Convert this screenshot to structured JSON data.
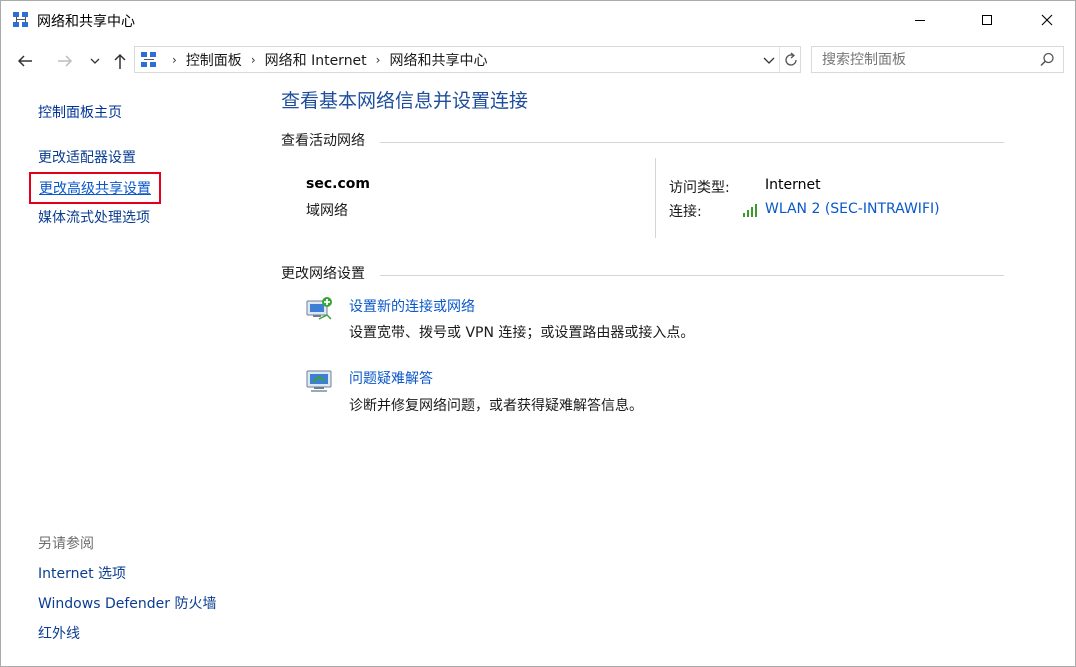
{
  "window": {
    "title": "网络和共享中心"
  },
  "nav": {
    "breadcrumbs": [
      "控制面板",
      "网络和 Internet",
      "网络和共享中心"
    ]
  },
  "search": {
    "placeholder": "搜索控制面板"
  },
  "sidebar": {
    "home": "控制面板主页",
    "links": [
      "更改适配器设置",
      "更改高级共享设置",
      "媒体流式处理选项"
    ],
    "see_also_title": "另请参阅",
    "see_also": [
      "Internet 选项",
      "Windows Defender 防火墙",
      "红外线"
    ]
  },
  "main": {
    "title": "查看基本网络信息并设置连接",
    "active_section": "查看活动网络",
    "network": {
      "name": "sec.com",
      "category": "域网络",
      "access_label": "访问类型:",
      "access_value": "Internet",
      "connection_label": "连接:",
      "connection_value": "WLAN 2 (SEC-INTRAWIFI)"
    },
    "change_section": "更改网络设置",
    "tasks": [
      {
        "title": "设置新的连接或网络",
        "desc": "设置宽带、拨号或 VPN 连接；或设置路由器或接入点。"
      },
      {
        "title": "问题疑难解答",
        "desc": "诊断并修复网络问题，或者获得疑难解答信息。"
      }
    ]
  },
  "colors": {
    "link": "#0a58ca",
    "title": "#1e4e9c",
    "highlight_box": "#e4001b"
  }
}
